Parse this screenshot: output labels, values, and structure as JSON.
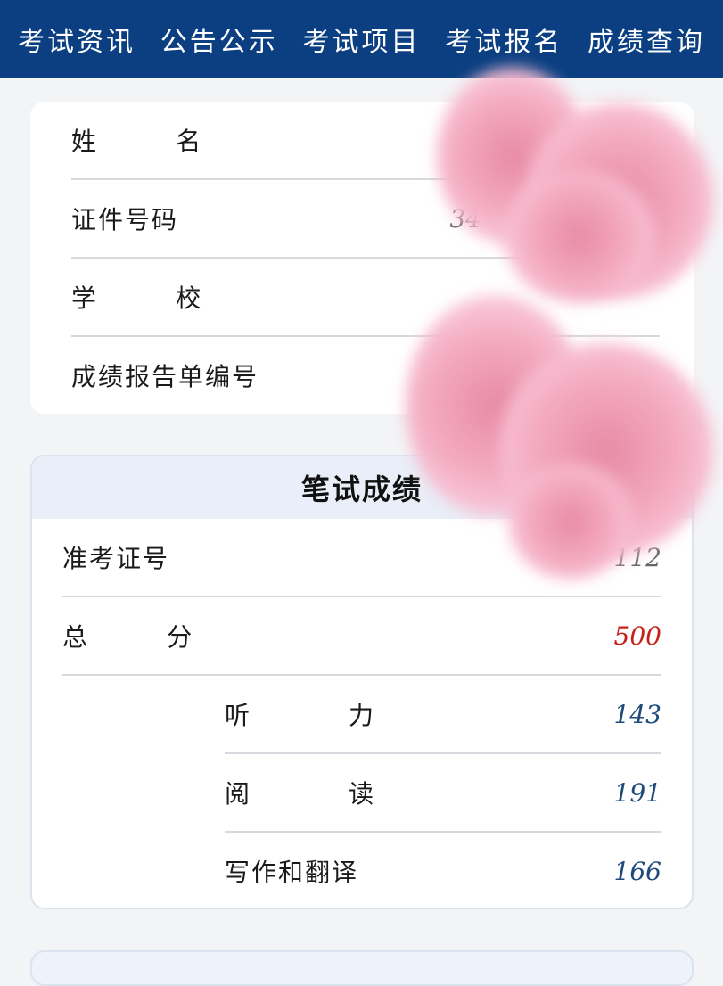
{
  "nav": {
    "items": [
      "考试资讯",
      "公告公示",
      "考试项目",
      "考试报名",
      "成绩查询"
    ]
  },
  "info": {
    "rows": [
      {
        "label": "姓        名",
        "value": ""
      },
      {
        "label": "证件号码",
        "value": "34"
      },
      {
        "label": "学        校",
        "value": ""
      },
      {
        "label": "成绩报告单编号",
        "value": ""
      }
    ]
  },
  "written": {
    "title": "笔试成绩",
    "ticket_label": "准考证号",
    "ticket_value": "112",
    "total_label": "总        分",
    "total_value": "500",
    "sub_rows": [
      {
        "label": "听          力",
        "value": "143"
      },
      {
        "label": "阅          读",
        "value": "191"
      },
      {
        "label": "写作和翻译",
        "value": "166"
      }
    ]
  },
  "colors": {
    "nav_bg": "#0b3f82",
    "total_value": "#c62019",
    "sub_value": "#1f4b7a"
  }
}
